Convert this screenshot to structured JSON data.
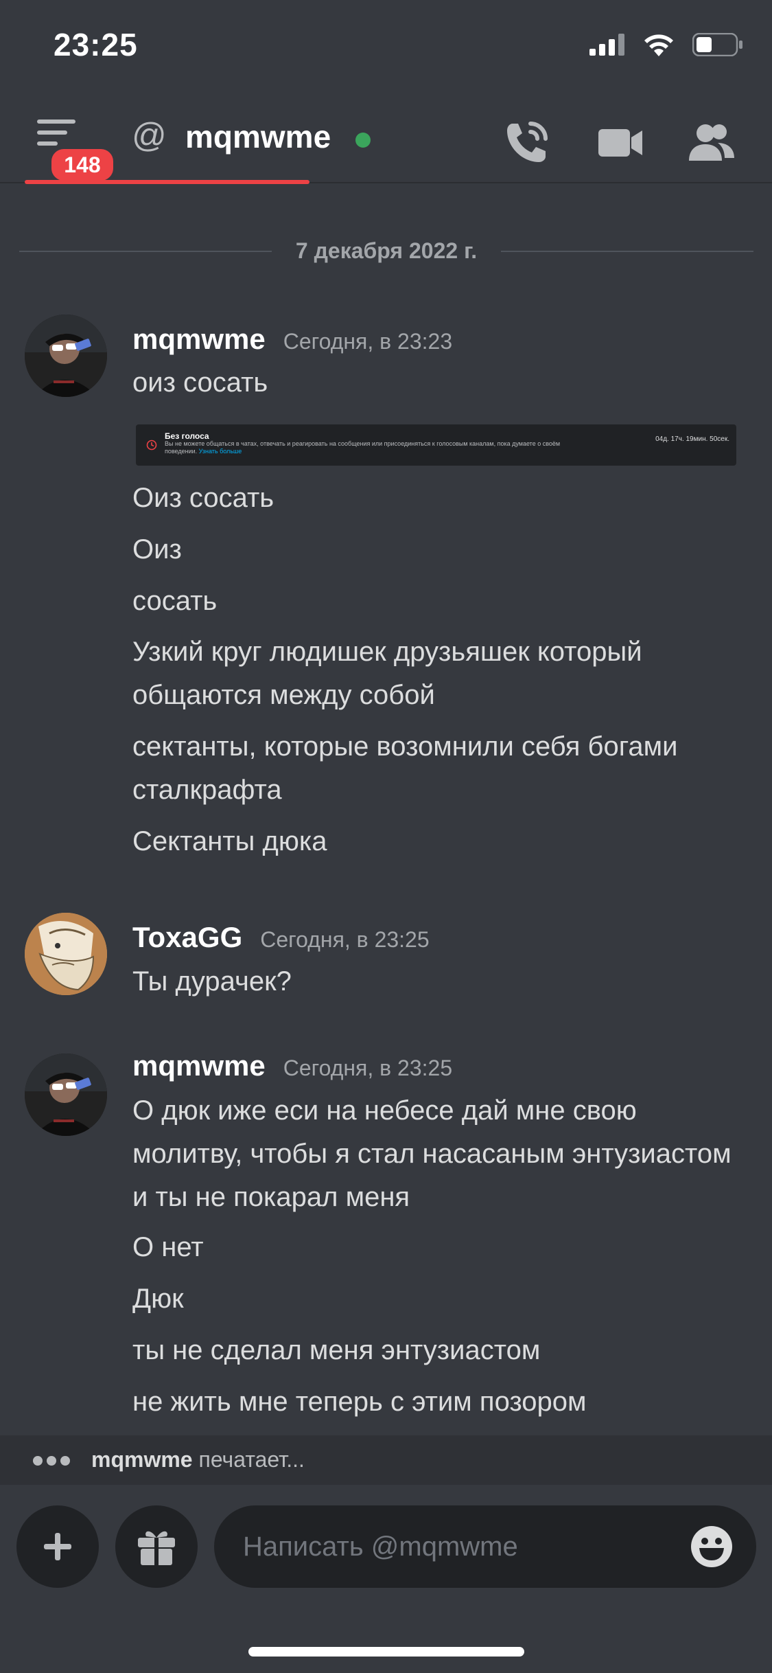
{
  "status_bar": {
    "time": "23:25"
  },
  "header": {
    "unread_badge": "148",
    "channel_name": "mqmwme",
    "online_status": "online",
    "icons": [
      "hamburger-menu-icon",
      "at-icon",
      "phone-call-icon",
      "video-camera-icon",
      "members-icon"
    ]
  },
  "date_divider": "7 декабря 2022 г.",
  "messages": [
    {
      "author": "mqmwme",
      "timestamp": "Сегодня, в 23:23",
      "lines": [
        "оиз сосать"
      ],
      "embed": {
        "title": "Без голоса",
        "text": "Вы не можете общаться в чатах, отвечать и реагировать на сообщения или присоединяться к голосовым каналам, пока думаете о своём поведении.",
        "link": "Узнать больше",
        "timer": "04д. 17ч. 19мин. 50сек."
      },
      "lines_after": [
        "Оиз сосать",
        "Оиз",
        "сосать",
        "Узкий круг людишек друзьяшек который общаются между собой",
        "сектанты, которые возомнили себя богами сталкрафта",
        "Сектанты дюка"
      ]
    },
    {
      "author": "ToxaGG",
      "timestamp": "Сегодня, в 23:25",
      "lines": [
        "Ты дурачек?"
      ]
    },
    {
      "author": "mqmwme",
      "timestamp": "Сегодня, в 23:25",
      "lines": [
        "О дюк иже еси на небесе дай мне свою молитву, чтобы я стал насасаным энтузиастом и ты не покарал меня",
        "О нет",
        "Дюк",
        "ты не сделал меня энтузиастом",
        "не жить мне теперь с этим позором"
      ]
    }
  ],
  "typing": {
    "user": "mqmwme",
    "text": "печатает..."
  },
  "composer": {
    "placeholder": "Написать @mqmwme",
    "icons": [
      "plus-icon",
      "gift-icon",
      "emoji-icon"
    ]
  },
  "colors": {
    "background": "#36393f",
    "badge": "#ed4245",
    "online": "#3ba55c",
    "input_bg": "#202225"
  }
}
